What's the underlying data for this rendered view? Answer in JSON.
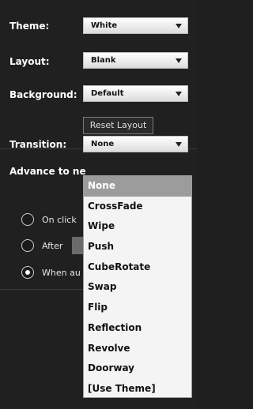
{
  "theme": {
    "label": "Theme:",
    "value": "White"
  },
  "layout": {
    "label": "Layout:",
    "value": "Blank"
  },
  "background": {
    "label": "Background:",
    "value": "Default"
  },
  "reset_button": "Reset Layout",
  "transition": {
    "label": "Transition:",
    "value": "None",
    "options": [
      "None",
      "CrossFade",
      "Wipe",
      "Push",
      "CubeRotate",
      "Swap",
      "Flip",
      "Reflection",
      "Revolve",
      "Doorway",
      "[Use Theme]"
    ],
    "selected_index": 0
  },
  "advance": {
    "label": "Advance to ne",
    "options": [
      {
        "label": "On click",
        "checked": false
      },
      {
        "label": "After",
        "checked": false
      },
      {
        "label": "When au",
        "checked": true
      }
    ]
  },
  "colors": {
    "panel": "#202020",
    "dropdown_bg": "#f4f4f4",
    "highlight": "#9c9c9c"
  }
}
